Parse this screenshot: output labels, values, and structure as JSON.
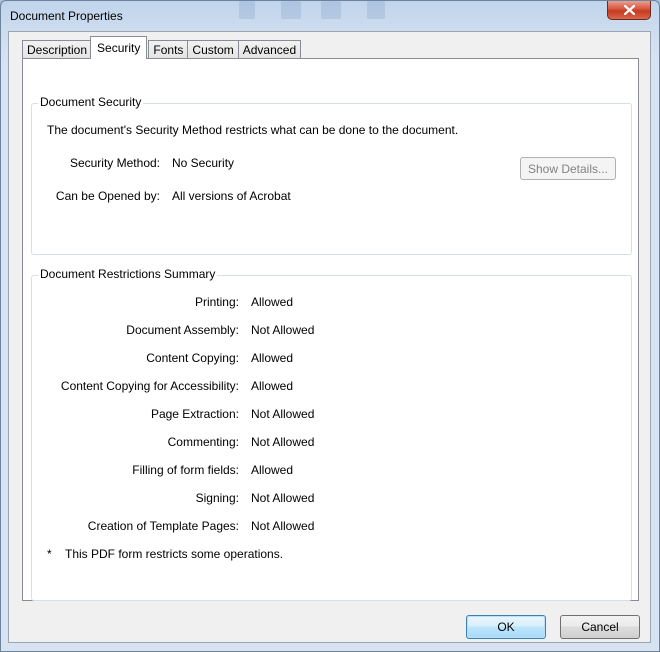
{
  "window": {
    "title": "Document Properties"
  },
  "tabs": [
    {
      "label": "Description"
    },
    {
      "label": "Security"
    },
    {
      "label": "Fonts"
    },
    {
      "label": "Custom"
    },
    {
      "label": "Advanced"
    }
  ],
  "active_tab": "Security",
  "security": {
    "legend": "Document Security",
    "description": "The document's Security Method restricts what can be done to the document.",
    "method_label": "Security Method:",
    "method_value": "No Security",
    "opened_label": "Can be Opened by:",
    "opened_value": "All versions of Acrobat",
    "show_details_label": "Show Details..."
  },
  "restrictions": {
    "legend": "Document Restrictions Summary",
    "items": [
      {
        "label": "Printing:",
        "value": "Allowed"
      },
      {
        "label": "Document Assembly:",
        "value": "Not Allowed"
      },
      {
        "label": "Content Copying:",
        "value": "Allowed"
      },
      {
        "label": "Content Copying for Accessibility:",
        "value": "Allowed"
      },
      {
        "label": "Page Extraction:",
        "value": "Not Allowed"
      },
      {
        "label": "Commenting:",
        "value": "Not Allowed"
      },
      {
        "label": "Filling of form fields:",
        "value": "Allowed"
      },
      {
        "label": "Signing:",
        "value": "Not Allowed"
      },
      {
        "label": "Creation of Template Pages:",
        "value": "Not Allowed"
      }
    ],
    "note_star": "*",
    "note": "This PDF form restricts some operations."
  },
  "footer": {
    "ok_label": "OK",
    "cancel_label": "Cancel"
  },
  "icons": {
    "close": "close-icon"
  },
  "colors": {
    "default_button_border": "#3c7fb1",
    "close_button": "#c43a1f"
  }
}
